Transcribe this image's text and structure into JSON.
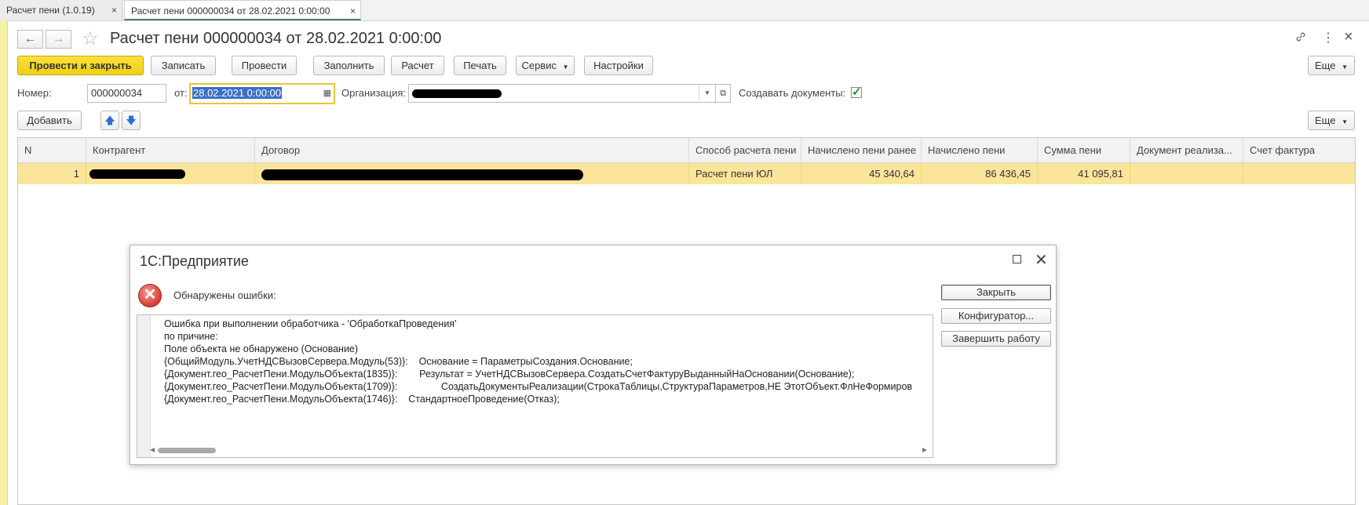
{
  "tabs": [
    {
      "label": "Расчет пени (1.0.19)",
      "close": "×"
    },
    {
      "label": "Расчет пени 000000034 от 28.02.2021 0:00:00",
      "close": "×"
    }
  ],
  "window": {
    "title": "Расчет пени 000000034 от 28.02.2021 0:00:00",
    "back_icon": "arrow-left-icon",
    "forward_icon": "arrow-right-icon",
    "favorite_icon": "star-icon",
    "link_icon": "link-icon",
    "more_icon": "vertical-dots-icon",
    "close": "×"
  },
  "toolbar": {
    "post_close": "Провести и закрыть",
    "save": "Записать",
    "post": "Провести",
    "fill": "Заполнить",
    "calc": "Расчет",
    "print": "Печать",
    "service": "Сервис",
    "settings": "Настройки",
    "more": "Еще"
  },
  "form": {
    "number_label": "Номер:",
    "number_value": "000000034",
    "date_label": "от:",
    "date_value": "28.02.2021  0:00:00",
    "org_label": "Организация:",
    "create_docs_label": "Создавать документы:",
    "create_docs_checked": "✓"
  },
  "table_toolbar": {
    "add": "Добавить",
    "more": "Еще"
  },
  "table": {
    "columns": [
      "N",
      "Контрагент",
      "Договор",
      "Способ расчета пени",
      "Начислено пени ранее",
      "Начислено пени",
      "Сумма пени",
      "Документ реализа...",
      "Счет фактура"
    ],
    "rows": [
      {
        "n": "1",
        "method": "Расчет пени ЮЛ",
        "accrued_before": "45 340,64",
        "accrued": "86 436,45",
        "sum": "41 095,81"
      }
    ]
  },
  "dialog": {
    "title": "1С:Предприятие",
    "message": "Обнаружены ошибки:",
    "lines": [
      "Ошибка при выполнении обработчика - 'ОбработкаПроведения'",
      "по причине:",
      "Поле объекта не обнаружено (Основание)",
      "{ОбщийМодуль.УчетНДСВызовСервера.Модуль(53)}:    Основание = ПараметрыСоздания.Основание;",
      "{Документ.гео_РасчетПени.МодульОбъекта(1835)}:        Результат = УчетНДСВызовСервера.СоздатьСчетФактуруВыданныйНаОсновании(Основание);",
      "{Документ.гео_РасчетПени.МодульОбъекта(1709)}:                СоздатьДокументыРеализации(СтрокаТаблицы,СтруктураПараметров,НЕ ЭтотОбъект.ФлНеФормиров",
      "{Документ.гео_РасчетПени.МодульОбъекта(1746)}:    СтандартноеПроведение(Отказ);"
    ],
    "btn_close": "Закрыть",
    "btn_configurator": "Конфигуратор...",
    "btn_exit": "Завершить работу"
  }
}
